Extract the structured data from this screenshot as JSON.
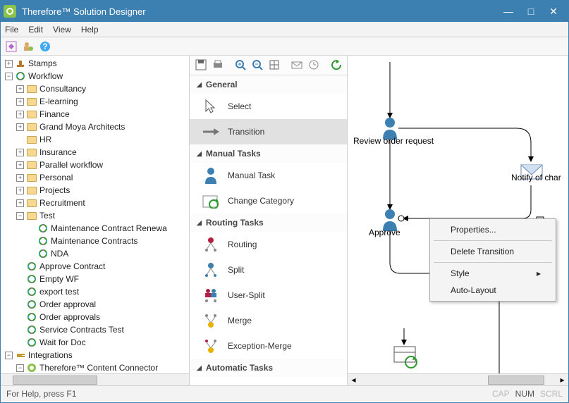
{
  "title": "Therefore™ Solution Designer",
  "menu": {
    "file": "File",
    "edit": "Edit",
    "view": "View",
    "help": "Help"
  },
  "tree": {
    "stamps": "Stamps",
    "workflow": "Workflow",
    "wf_folders": [
      "Consultancy",
      "E-learning",
      "Finance",
      "Grand Moya Architects",
      "HR",
      "Insurance",
      "Parallel workflow",
      "Personal",
      "Projects",
      "Recruitment"
    ],
    "test": "Test",
    "test_children": [
      "Maintenance Contract Renewa",
      "Maintenance Contracts",
      "NDA"
    ],
    "wf_items": [
      "Approve Contract",
      "Empty WF",
      "export test",
      "Order approval",
      "Order approvals",
      "Service Contracts Test",
      "Wait for Doc"
    ],
    "integrations": "Integrations",
    "connector": "Therefore™ Content Connector"
  },
  "palette": {
    "groups": {
      "general": "General",
      "manual": "Manual Tasks",
      "routing": "Routing Tasks",
      "automatic": "Automatic Tasks"
    },
    "items": {
      "select": "Select",
      "transition": "Transition",
      "manual_task": "Manual Task",
      "change_category": "Change Category",
      "routing": "Routing",
      "split": "Split",
      "user_split": "User-Split",
      "merge": "Merge",
      "exception_merge": "Exception-Merge"
    }
  },
  "canvas": {
    "n1": "Review order request",
    "n2": "Approve",
    "n3": "Notify of char"
  },
  "context_menu": {
    "properties": "Properties...",
    "delete": "Delete Transition",
    "style": "Style",
    "auto": "Auto-Layout"
  },
  "status": {
    "help": "For Help, press F1",
    "cap": "CAP",
    "num": "NUM",
    "scrl": "SCRL"
  }
}
